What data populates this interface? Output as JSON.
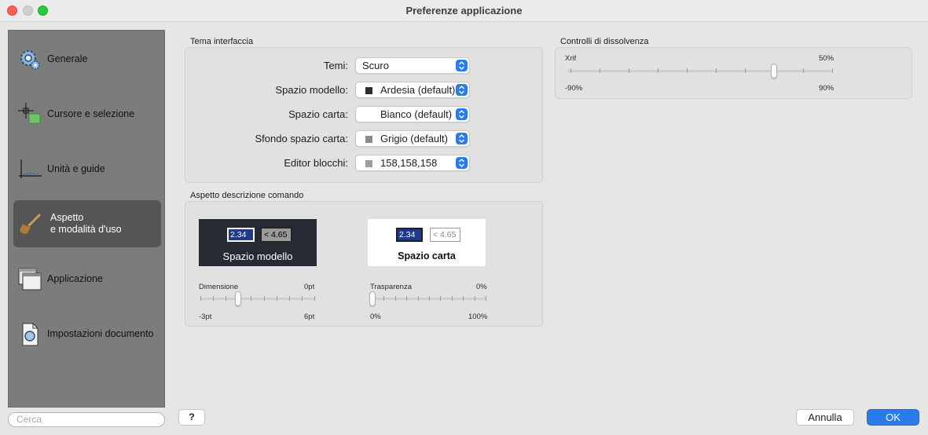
{
  "window": {
    "title": "Preferenze applicazione"
  },
  "sidebar": {
    "items": [
      {
        "label": "Generale",
        "icon": "gear-icon"
      },
      {
        "label": "Cursore e selezione",
        "icon": "crosshair-icon"
      },
      {
        "label": "Unità e guide",
        "icon": "units-icon"
      },
      {
        "label_line1": "Aspetto",
        "label_line2": "e modalità d'uso",
        "icon": "brush-icon",
        "active": true
      },
      {
        "label": "Applicazione",
        "icon": "windows-icon"
      },
      {
        "label": "Impostazioni documento",
        "icon": "document-icon"
      }
    ],
    "search_placeholder": "Cerca"
  },
  "theme": {
    "title": "Tema interfaccia",
    "rows": [
      {
        "label": "Temi:",
        "value": "Scuro"
      },
      {
        "label": "Spazio modello:",
        "value": "Ardesia (default)",
        "swatch": "#2a2e36"
      },
      {
        "label": "Spazio carta:",
        "value": "Bianco (default)",
        "swatch": "#ffffff"
      },
      {
        "label": "Sfondo spazio carta:",
        "value": "Grigio (default)",
        "swatch": "#8a8a8a"
      },
      {
        "label": "Editor blocchi:",
        "value": "158,158,158",
        "swatch": "#9e9e9e"
      }
    ]
  },
  "command": {
    "title": "Aspetto descrizione comando",
    "model_preview": {
      "value1": "2.34",
      "value2": "< 4.65",
      "caption": "Spazio modello"
    },
    "paper_preview": {
      "value1": "2.34",
      "value2": "< 4.65",
      "caption": "Spazio carta"
    },
    "size_slider": {
      "label": "Dimensione",
      "value": "0pt",
      "min": "-3pt",
      "max": "6pt",
      "level": 0.333
    },
    "transparency_slider": {
      "label": "Trasparenza",
      "value": "0%",
      "min": "0%",
      "max": "100%",
      "level": 0.0
    }
  },
  "fade": {
    "title": "Controlli di dissolvenza",
    "xref_slider": {
      "label": "Xrif",
      "value": "50%",
      "min": "-90%",
      "max": "90%",
      "level": 0.778
    }
  },
  "buttons": {
    "help": "?",
    "cancel": "Annulla",
    "ok": "OK"
  },
  "colors": {
    "accent": "#2a7be8",
    "sidebar_bg": "#7c7c7c",
    "sidebar_active": "#555555"
  }
}
